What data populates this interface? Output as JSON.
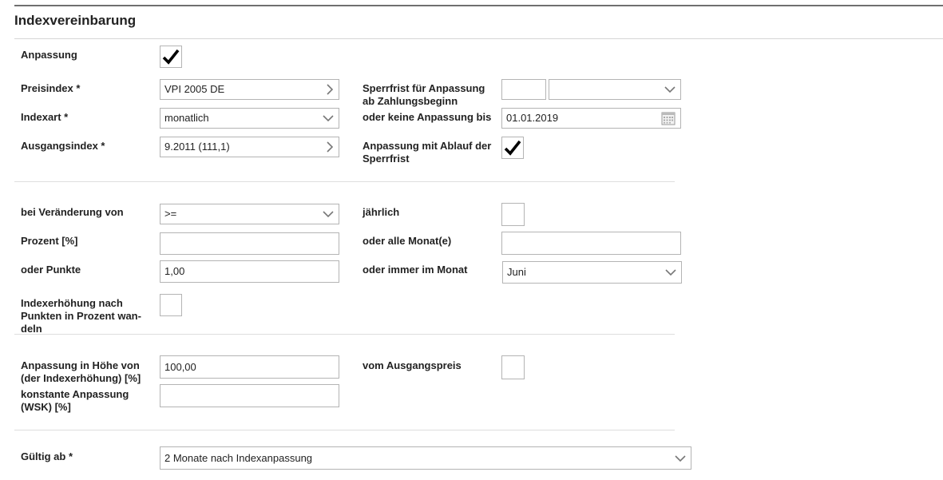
{
  "section": {
    "title": "Indexvereinbarung"
  },
  "block1": {
    "anpassung_label": "Anpassung",
    "preisindex_label": "Preisindex *",
    "preisindex_value": "VPI 2005 DE",
    "indexart_label": "Indexart *",
    "indexart_value": "monatlich",
    "ausgangsindex_label": "Ausgangsindex *",
    "ausgangsindex_value": "9.2011 (111,1)",
    "sperrfrist_label_1": "Sperrfrist für Anpassung",
    "sperrfrist_label_2": "ab Zahlungsbeginn",
    "sperrfrist_number": "",
    "sperrfrist_unit": "",
    "keine_anpassung_label": "oder keine Anpassung bis",
    "keine_anpassung_value": "01.01.2019",
    "ablauf_label_1": "Anpassung mit Ablauf der",
    "ablauf_label_2": "Sperrfrist"
  },
  "block2": {
    "veraenderung_label": "bei Veränderung von",
    "veraenderung_value": ">=",
    "prozent_label": "Prozent [%]",
    "prozent_value": "",
    "punkte_label": "oder Punkte",
    "punkte_value": "1,00",
    "wandeln_label_1": "Indexerhöhung nach",
    "wandeln_label_2": "Punkten in Prozent wan-",
    "wandeln_label_3": "deln",
    "jaehrlich_label": "jährlich",
    "monate_label": "oder alle Monat(e)",
    "monate_value": "",
    "monat_label": "oder immer im Monat",
    "monat_value": "Juni"
  },
  "block3": {
    "hoehe_label_1": "Anpassung in Höhe von",
    "hoehe_label_2": "(der Indexerhöhung) [%]",
    "hoehe_value": "100,00",
    "wsk_label_1": "konstante Anpassung",
    "wsk_label_2": "(WSK) [%]",
    "wsk_value": "",
    "ausgangspreis_label": "vom Ausgangspreis"
  },
  "block4": {
    "gueltig_label": "Gültig ab *",
    "gueltig_value": "2 Monate nach Indexanpassung"
  },
  "checkboxes": {
    "anpassung": true,
    "ablauf_sperrfrist": true,
    "jaehrlich": false,
    "wandeln": false,
    "ausgangspreis": false
  },
  "icons": {
    "chevron_right": "chevron-right-icon",
    "chevron_down": "chevron-down-icon",
    "calendar": "calendar-icon",
    "checkmark": "checkmark-icon"
  },
  "colors": {
    "border": "#b4b4b4",
    "divider": "#dedede",
    "header_rule": "#707070"
  }
}
